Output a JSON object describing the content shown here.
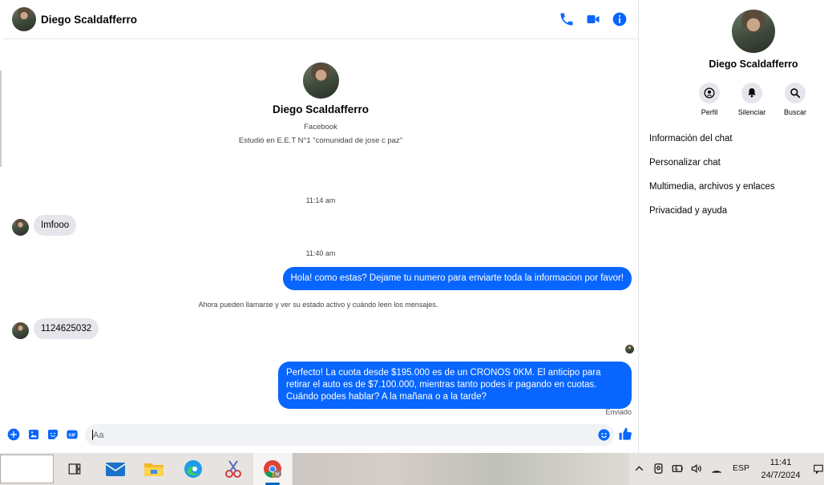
{
  "header": {
    "contact_name": "Diego Scaldafferro"
  },
  "profile": {
    "name": "Diego Scaldafferro",
    "platform": "Facebook",
    "bio": "Estudió en E.E.T N°1 \"comunidad de jose c paz\""
  },
  "messages": {
    "time1": "11:14 am",
    "msg1": "Imfooo",
    "time2": "11:40 am",
    "msg2": "Hola! como estas? Dejame tu numero para enviarte toda la informacion por favor!",
    "system_note": "Ahora pueden llamarse y ver su estado activo y cuándo leen los mensajes.",
    "msg3": "1124625032",
    "msg4": "Perfecto! La cuota desde $195.000 es de un CRONOS 0KM. El anticipo para retirar el auto es de $7.100.000, mientras tanto podes ir pagando en cuotas. Cuándo podes hablar? A la mañana o a la tarde?",
    "status": "Enviado"
  },
  "composer": {
    "placeholder": "Aa"
  },
  "side_panel": {
    "name": "Diego Scaldafferro",
    "buttons": [
      "Perfil",
      "Silenciar",
      "Buscar"
    ],
    "menu": [
      "Información del chat",
      "Personalizar chat",
      "Multimedia, archivos y enlaces",
      "Privacidad y ayuda"
    ]
  },
  "taskbar": {
    "language": "ESP",
    "time": "11:41",
    "date": "24/7/2024"
  },
  "colors": {
    "accent": "#0866ff",
    "incoming_bubble": "#e4e6eb"
  }
}
